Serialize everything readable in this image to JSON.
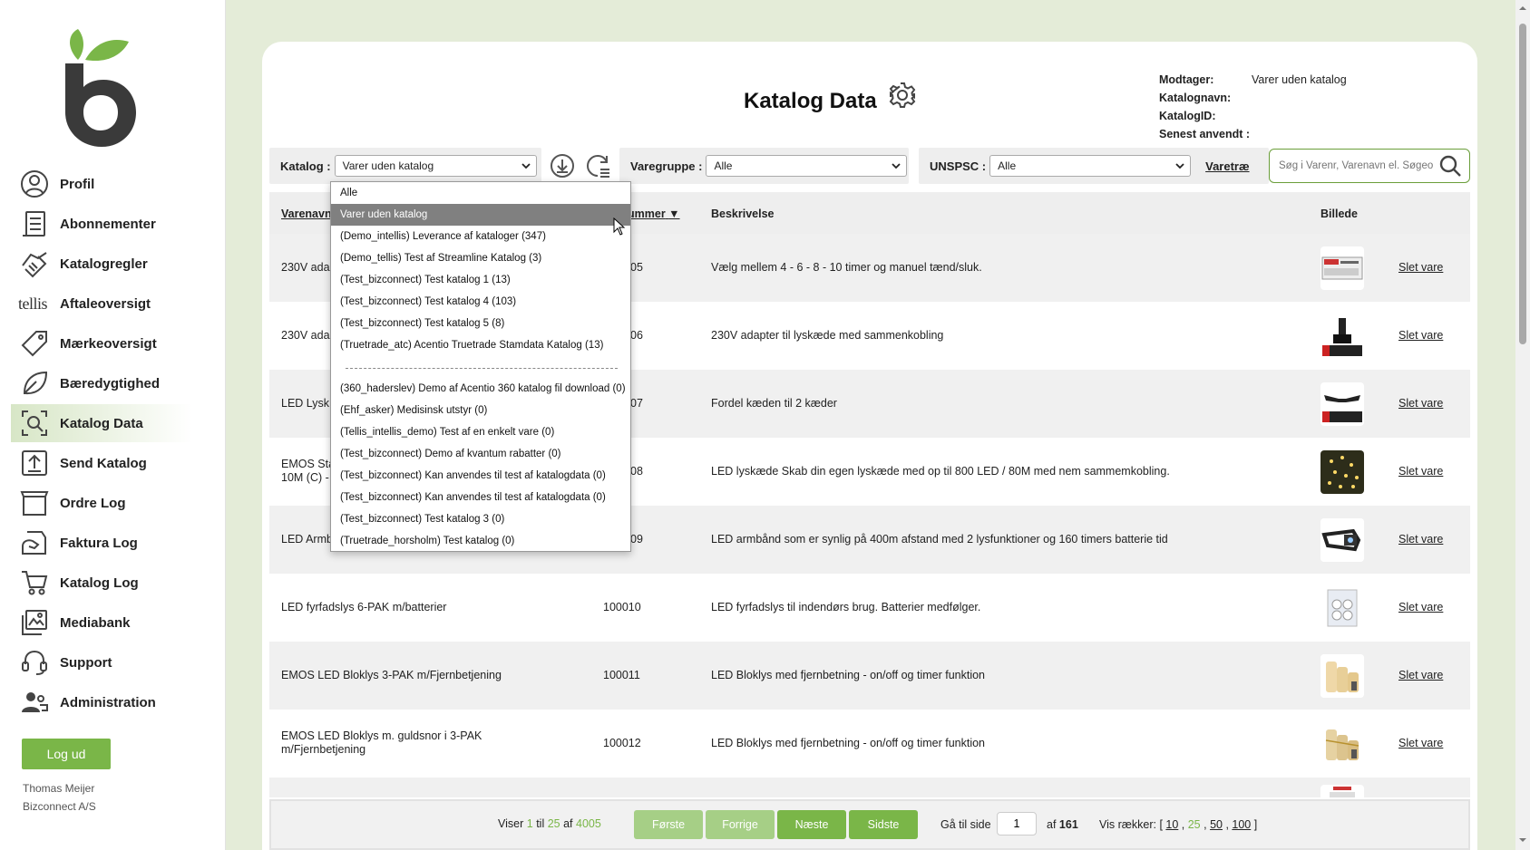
{
  "sidebar": {
    "items": [
      {
        "label": "Profil",
        "icon": "user-circle-icon"
      },
      {
        "label": "Abonnementer",
        "icon": "document-list-icon"
      },
      {
        "label": "Katalogregler",
        "icon": "handshake-icon"
      },
      {
        "label": "Aftaleoversigt",
        "icon": "tellis-logo-icon",
        "prefix": "tellis"
      },
      {
        "label": "Mærkeoversigt",
        "icon": "tag-icon"
      },
      {
        "label": "Bæredygtighed",
        "icon": "leaf-icon"
      },
      {
        "label": "Katalog Data",
        "icon": "search-document-icon",
        "active": true
      },
      {
        "label": "Send Katalog",
        "icon": "upload-icon"
      },
      {
        "label": "Ordre Log",
        "icon": "order-box-icon"
      },
      {
        "label": "Faktura Log",
        "icon": "invoice-icon"
      },
      {
        "label": "Katalog Log",
        "icon": "cart-icon"
      },
      {
        "label": "Mediabank",
        "icon": "media-icon"
      },
      {
        "label": "Support",
        "icon": "support-icon"
      },
      {
        "label": "Administration",
        "icon": "users-icon"
      }
    ],
    "logout_label": "Log ud",
    "user_name": "Thomas Meijer",
    "user_company": "Bizconnect A/S"
  },
  "header": {
    "title": "Katalog Data",
    "info": [
      {
        "key": "Modtager:",
        "value": "Varer uden katalog"
      },
      {
        "key": "Katalognavn:",
        "value": ""
      },
      {
        "key": "KatalogID:",
        "value": ""
      },
      {
        "key": "Senest anvendt :",
        "value": ""
      }
    ]
  },
  "filters": {
    "katalog_label": "Katalog :",
    "katalog_value": "Varer uden katalog",
    "varegruppe_label": "Varegruppe :",
    "varegruppe_value": "Alle",
    "unspsc_label": "UNSPSC :",
    "unspsc_value": "Alle",
    "varetrae_label": "Varetræ",
    "search_placeholder": "Søg i Varenr, Varenavn el. Søgeord"
  },
  "dropdown": {
    "options_top": [
      "Alle",
      "Varer uden katalog",
      "(Demo_intellis) Leverance af kataloger (347)",
      "(Demo_tellis) Test af Streamline Katalog (3)",
      "(Test_bizconnect) Test katalog 1 (13)",
      "(Test_bizconnect) Test katalog 4 (103)",
      "(Test_bizconnect) Test katalog 5 (8)",
      "(Truetrade_atc) Acentio Truetrade Stamdata Katalog (13)"
    ],
    "options_bottom": [
      "(360_haderslev) Demo af Acentio 360 katalog fil download (0)",
      "(Ehf_asker) Medisinsk utstyr (0)",
      "(Tellis_intellis_demo) Test af en enkelt vare (0)",
      "(Test_bizconnect) Demo af kvantum rabatter (0)",
      "(Test_bizconnect) Kan anvendes til test af katalogdata (0)",
      "(Test_bizconnect) Kan anvendes til test af katalogdata (0)",
      "(Test_bizconnect) Test katalog 3 (0)",
      "(Truetrade_horsholm) Test katalog (0)"
    ],
    "selected": "Varer uden katalog"
  },
  "table": {
    "headers": {
      "name": "Varenavn",
      "number": "ummer",
      "description": "Beskrivelse",
      "image": "Billede"
    },
    "rows": [
      {
        "name": "230V adap",
        "number": "05",
        "description": "Vælg mellem 4 - 6 - 8 - 10 timer og manuel tænd/sluk.",
        "delete": "Slet vare",
        "thumb": "timer"
      },
      {
        "name": "230V adap",
        "number": "06",
        "description": "230V adapter til lyskæde med sammenkobling",
        "delete": "Slet vare",
        "thumb": "adapter"
      },
      {
        "name": "LED Lysk",
        "number": "07",
        "description": "Fordel kæden til 2 kæder",
        "delete": "Slet vare",
        "thumb": "splitter"
      },
      {
        "name": "EMOS Sta",
        "name2": "10M (C) -",
        "number": "08",
        "description": "LED lyskæde Skab din egen lyskæde med op til 800 LED / 80M med nem sammemkobling.",
        "delete": "Slet vare",
        "thumb": "lights"
      },
      {
        "name": "LED Armb",
        "number": "09",
        "description": "LED armbånd som er synlig på 400m afstand med 2 lysfunktioner og 160 timers batterie tid",
        "delete": "Slet vare",
        "thumb": "armband"
      },
      {
        "name": "LED fyrfadslys 6-PAK m/batterier",
        "number": "100010",
        "description": "LED fyrfadslys til indendørs brug. Batterier medfølger.",
        "delete": "Slet vare",
        "thumb": "tealights"
      },
      {
        "name": "EMOS LED Bloklys 3-PAK m/Fjernbetjening",
        "number": "100011",
        "description": "LED Bloklys med fjernbetning - on/off og timer funktion",
        "delete": "Slet vare",
        "thumb": "candles"
      },
      {
        "name": "EMOS LED Bloklys m. guldsnor i 3-PAK",
        "name2": "m/Fjernbetjening",
        "number": "100012",
        "description": "LED Bloklys med fjernbetning - on/off og timer funktion",
        "delete": "Slet vare",
        "thumb": "candles-gold"
      }
    ]
  },
  "pagination": {
    "viser": "Viser",
    "from": "1",
    "til": "til",
    "to": "25",
    "af": "af",
    "total": "4005",
    "first": "Første",
    "prev": "Forrige",
    "next": "Næste",
    "last": "Sidste",
    "goto_label": "Gå til side",
    "goto_value": "1",
    "of_label": "af",
    "pages": "161",
    "rows_label": "Vis rækker: [",
    "rows_options": [
      "10",
      "25",
      "50",
      "100"
    ],
    "rows_current": "25",
    "rows_close": "]"
  },
  "colors": {
    "accent": "#7ab648",
    "page_bg": "#e4ecd8",
    "logo_leaf": "#7ab648",
    "logo_b": "#3a3a3a"
  }
}
